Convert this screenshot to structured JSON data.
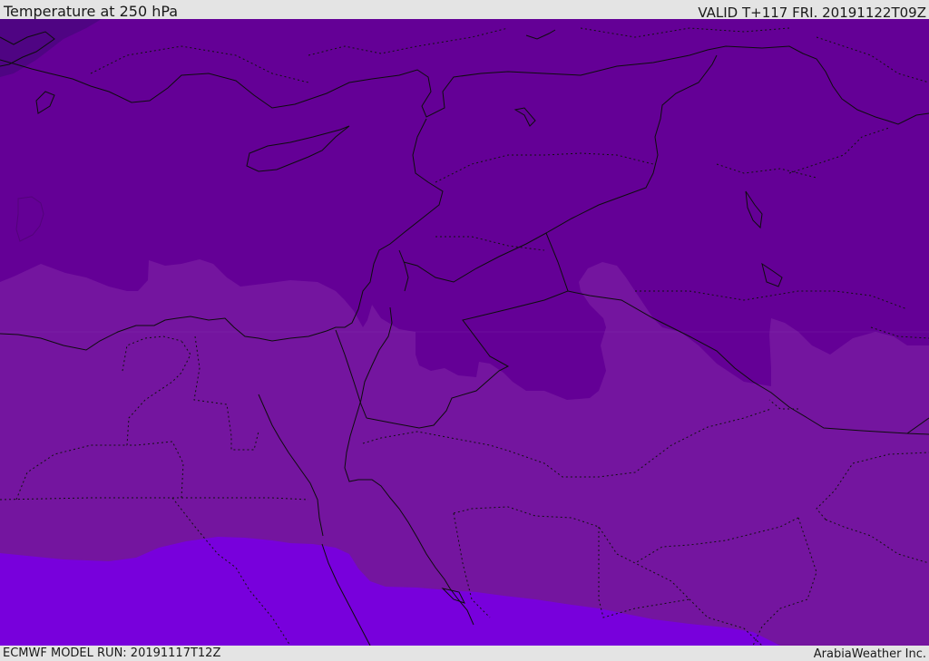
{
  "header": {
    "title": "Temperature at 250 hPa",
    "valid": "VALID T+117 FRI. 20191122T09Z"
  },
  "footer": {
    "model_run": "ECMWF MODEL RUN: 20191117T12Z",
    "credit": "ArabiaWeather Inc."
  },
  "map": {
    "field": "temperature",
    "level": "250 hPa",
    "colors": {
      "coldest": "#4f0483",
      "cold": "#640096",
      "mid": "#72169f",
      "warm": "#7800dc",
      "lines": "#111111"
    }
  }
}
